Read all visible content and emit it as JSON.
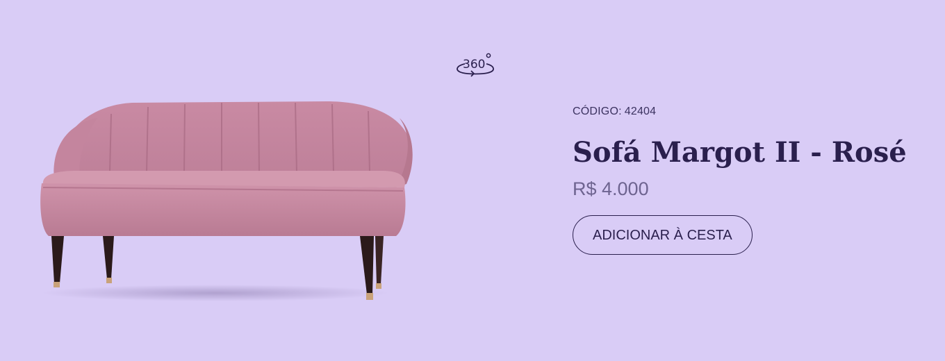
{
  "viewer": {
    "icon": "rotate-360-icon",
    "label": "360°"
  },
  "product": {
    "image_icon": "sofa-image",
    "colors": {
      "upholstery": "#c98aa3",
      "legs": "#2b1a1a",
      "background": "#d9ccf6"
    },
    "code_label": "CÓDIGO:",
    "code_value": "42404",
    "title": "Sofá Margot II - Rosé",
    "price": "R$ 4.000",
    "add_to_cart_label": "ADICIONAR À CESTA"
  },
  "theme": {
    "text": "#2a1f4d",
    "muted": "#6e6490"
  }
}
